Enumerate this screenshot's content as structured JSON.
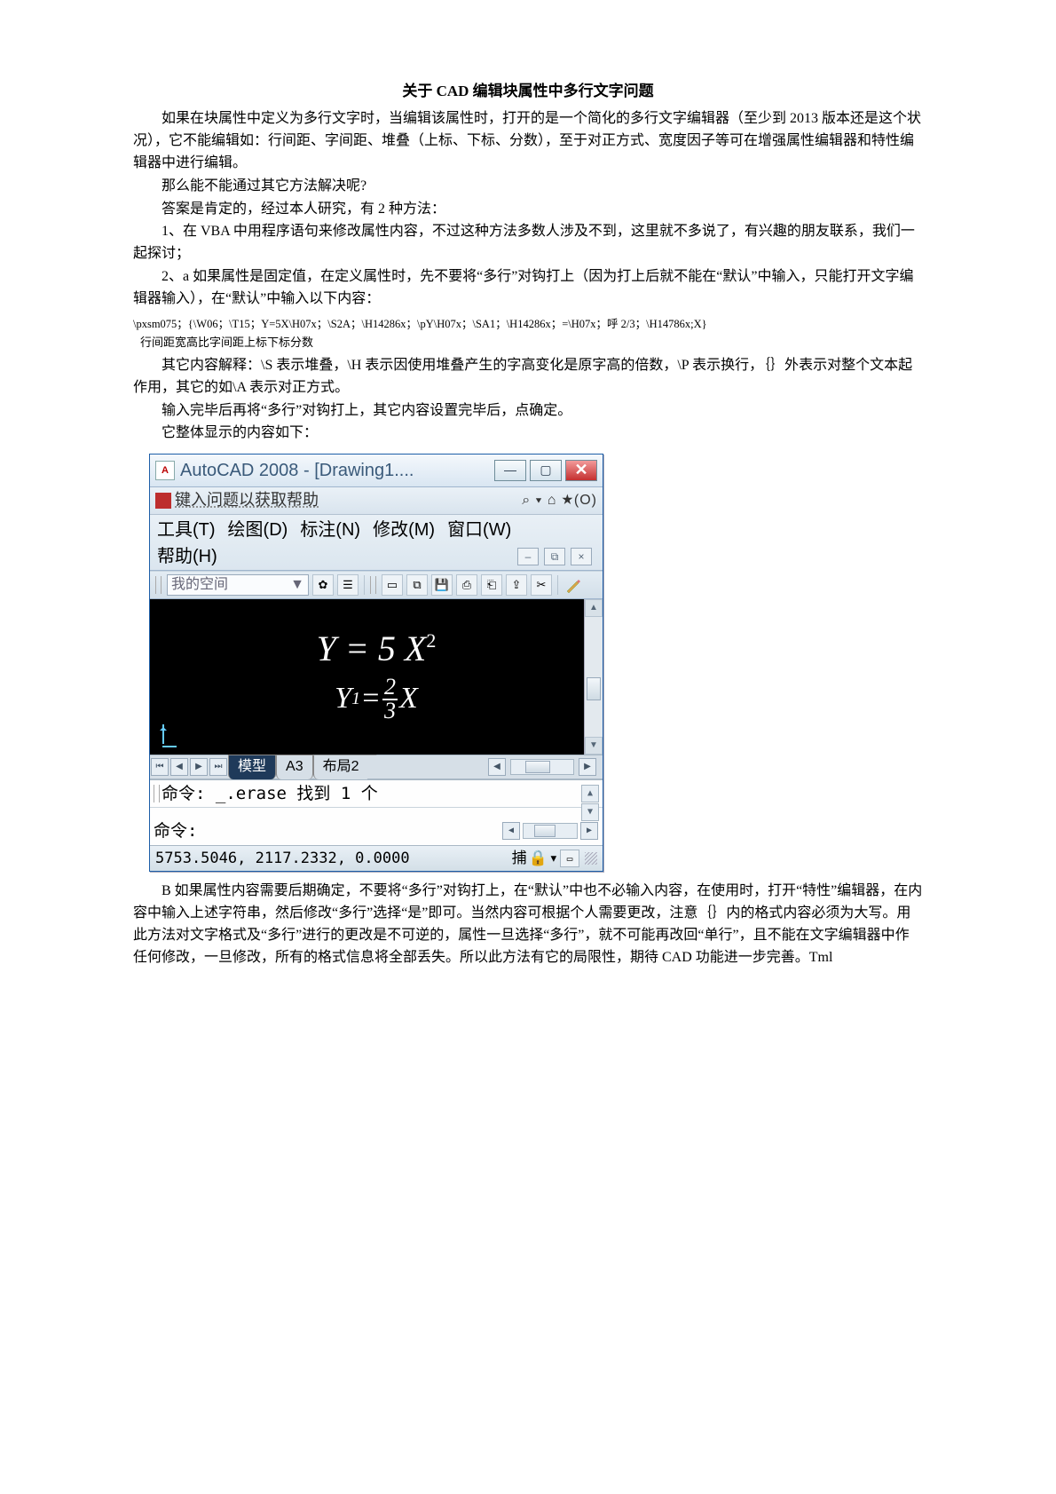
{
  "doc": {
    "title": "关于 CAD 编辑块属性中多行文字问题",
    "p1": "如果在块属性中定义为多行文字时，当编辑该属性时，打开的是一个简化的多行文字编辑器（至少到 2013 版本还是这个状况），它不能编辑如：行间距、字间距、堆叠（上标、下标、分数），至于对正方式、宽度因子等可在增强属性编辑器和特性编辑器中进行编辑。",
    "p2": "那么能不能通过其它方法解决呢?",
    "p3": "答案是肯定的，经过本人研究，有 2 种方法：",
    "p4": "1、在 VBA 中用程序语句来修改属性内容，不过这种方法多数人涉及不到，这里就不多说了，有兴趣的朋友联系，我们一起探讨；",
    "p5": "2、a 如果属性是固定值，在定义属性时，先不要将“多行”对钩打上（因为打上后就不能在“默认”中输入，只能打开文字编辑器输入），在“默认”中输入以下内容：",
    "code": "\\pxsm075；{\\W06；\\T15；Y=5X\\H07x；\\S2A；\\H14286x；\\pY\\H07x；\\SA1；\\H14286x；=\\H07x；呼 2/3；\\H14786x;X}",
    "note": "行间距宽高比字间距上标下标分数",
    "p6": "其它内容解释：\\S 表示堆叠，\\H 表示因使用堆叠产生的字高变化是原字高的倍数，\\P 表示换行，｛｝外表示对整个文本起作用，其它的如\\A 表示对正方式。",
    "p7": "输入完毕后再将“多行”对钩打上，其它内容设置完毕后，点确定。",
    "p8": "它整体显示的内容如下：",
    "p9": "B 如果属性内容需要后期确定，不要将“多行”对钩打上，在“默认”中也不必输入内容，在使用时，打开“特性”编辑器，在内容中输入上述字符串，然后修改“多行”选择“是”即可。当然内容可根据个人需要更改，注意｛｝内的格式内容必须为大写。用此方法对文字格式及“多行”进行的更改是不可逆的，属性一旦选择“多行”，就不可能再改回“单行”，且不能在文字编辑器中作任何修改，一旦修改，所有的格式信息将全部丢失。所以此方法有它的局限性，期待 CAD 功能进一步完善。Tml"
  },
  "cad": {
    "titlebar": "AutoCAD 2008 - [Drawing1....",
    "help_prompt": "键入问题以获取帮助",
    "help_right": "⌕ ▾ ⌂ ★(O)",
    "menu": {
      "tools": "工具(T)",
      "draw": "绘图(D)",
      "dimension": "标注(N)",
      "modify": "修改(M)",
      "window": "窗口(W)",
      "help": "帮助(H)"
    },
    "workspace": "我的空间",
    "canvas": {
      "eq1_a": "Y = 5 X",
      "eq1_sup": "2",
      "eq2_a": "Y",
      "eq2_sub": "1",
      "eq2_eq": "=",
      "frac_num": "2",
      "frac_den": "3",
      "eq2_b": "X"
    },
    "tabs": {
      "model": "模型",
      "a3": "A3",
      "layout2": "布局2"
    },
    "cmd": {
      "prev": "命令:  _.erase 找到 1 个",
      "prompt": "命令:"
    },
    "status": {
      "coords": "5753.5046, 2117.2332, 0.0000",
      "snap": "捕"
    }
  }
}
